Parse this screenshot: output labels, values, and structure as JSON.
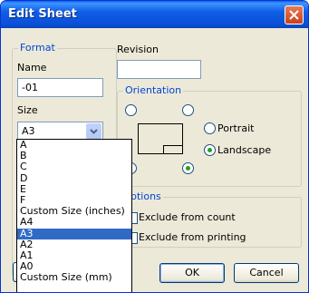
{
  "window": {
    "title": "Edit Sheet"
  },
  "format": {
    "legend": "Format",
    "name_label": "Name",
    "name_value": "-01",
    "size_label": "Size",
    "size_value": "A3"
  },
  "revision": {
    "label": "Revision",
    "value": ""
  },
  "orientation": {
    "legend": "Orientation",
    "portrait_label": "Portrait",
    "landscape_label": "Landscape",
    "selected": "Landscape"
  },
  "options": {
    "legend": "ptions",
    "exclude_count_label": "Exclude from count",
    "exclude_printing_label": "Exclude from printing"
  },
  "buttons": {
    "ok": "OK",
    "cancel": "Cancel"
  },
  "size_dropdown": {
    "items": [
      "A",
      "B",
      "C",
      "D",
      "E",
      "F",
      "Custom Size (inches)",
      "A4",
      "A3",
      "A2",
      "A1",
      "A0",
      "Custom Size (mm)"
    ],
    "selected": "A3"
  }
}
